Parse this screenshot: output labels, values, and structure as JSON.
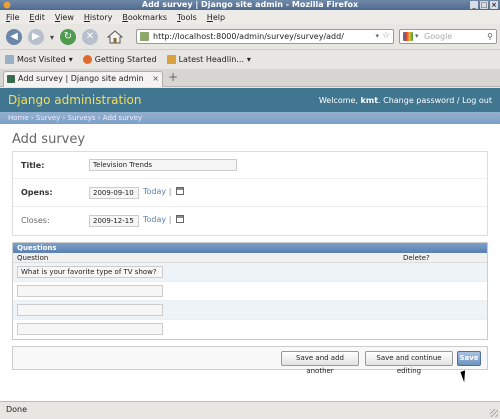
{
  "window": {
    "title": "Add survey | Django site admin - Mozilla Firefox"
  },
  "menubar": {
    "items": [
      "File",
      "Edit",
      "View",
      "History",
      "Bookmarks",
      "Tools",
      "Help"
    ]
  },
  "navbar": {
    "url": "http://localhost:8000/admin/survey/survey/add/",
    "search_placeholder": "Google"
  },
  "bookmarks": {
    "items": [
      {
        "label": "Most Visited",
        "dropdown": "▾"
      },
      {
        "label": "Getting Started",
        "dropdown": ""
      },
      {
        "label": "Latest Headlin...",
        "dropdown": "▾"
      }
    ]
  },
  "tabs": {
    "active": {
      "label": "Add survey | Django site admin"
    },
    "close_glyph": "×",
    "new_glyph": "+"
  },
  "admin": {
    "brand": "Django administration",
    "welcome_prefix": "Welcome,",
    "username": "kmt",
    "change_password": "Change password",
    "separator": " / ",
    "logout": "Log out",
    "breadcrumbs": [
      "Home",
      "Survey",
      "Surveys",
      "Add survey"
    ],
    "breadcrumb_sep": " › ",
    "page_title": "Add survey"
  },
  "form": {
    "title_label": "Title:",
    "title_value": "Television Trends",
    "opens_label": "Opens:",
    "opens_value": "2009-09-10",
    "closes_label": "Closes:",
    "closes_value": "2009-12-15",
    "today_link": "Today",
    "date_sep": "|"
  },
  "inline": {
    "caption": "Questions",
    "col_question": "Question",
    "col_delete": "Delete?",
    "rows": [
      "What is your favorite type of TV show?",
      "",
      "",
      ""
    ]
  },
  "buttons": {
    "save_add_another": "Save and add another",
    "save_continue": "Save and continue editing",
    "save": "Save"
  },
  "status": {
    "text": "Done"
  },
  "colors": {
    "django_header": "#417690",
    "brand_text": "#f5dd5d",
    "breadcrumb_bg": "#7ca0c7",
    "link": "#5b80b2"
  }
}
